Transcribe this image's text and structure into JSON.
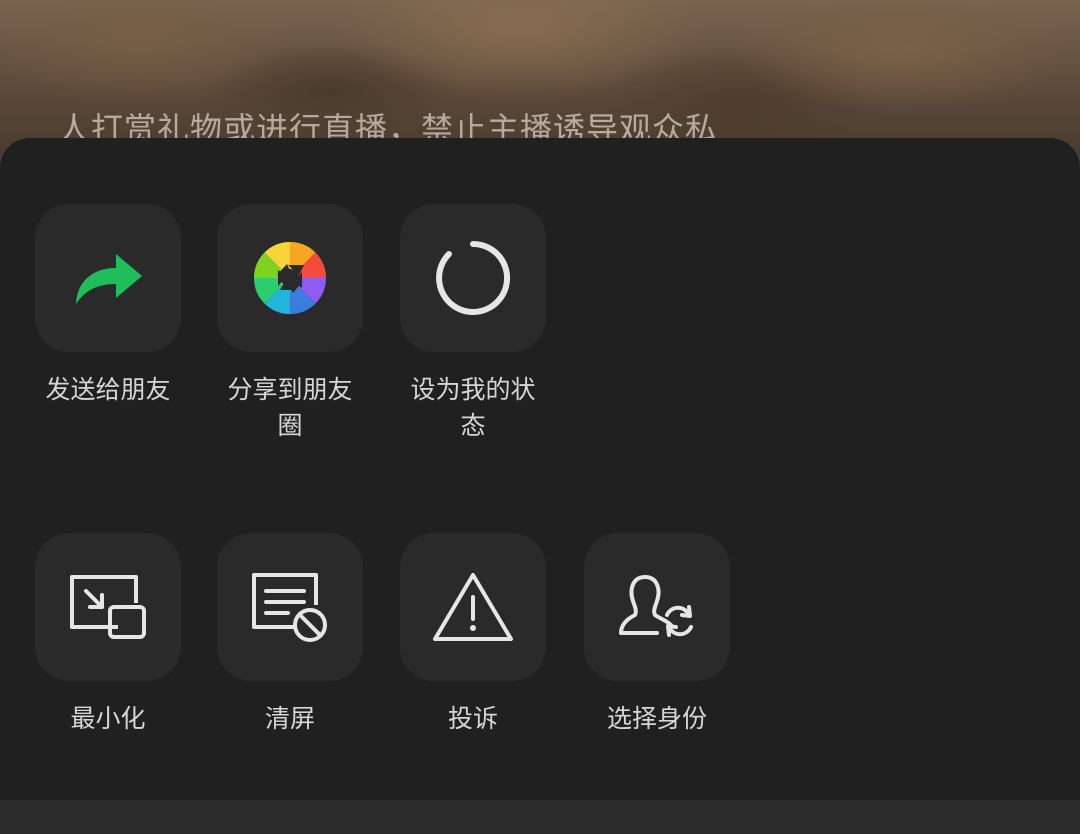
{
  "background": {
    "notice_text": "人打赏礼物或进行直播，禁止主播诱导观众私"
  },
  "share_row": [
    {
      "label": "发送给朋友",
      "icon": "forward-arrow-icon"
    },
    {
      "label": "分享到朋友圈",
      "icon": "moments-aperture-icon"
    },
    {
      "label": "设为我的状态",
      "icon": "status-ring-icon"
    }
  ],
  "action_row": [
    {
      "label": "最小化",
      "icon": "minimize-icon"
    },
    {
      "label": "清屏",
      "icon": "clear-screen-icon"
    },
    {
      "label": "投诉",
      "icon": "warning-icon"
    },
    {
      "label": "选择身份",
      "icon": "switch-identity-icon"
    }
  ],
  "colors": {
    "sheet_background": "#202020",
    "tile_background": "#2a2a2a",
    "forward_arrow": "#1fbe5a",
    "icon_stroke": "#e6e6e6",
    "label_text": "#d6d6d6"
  }
}
